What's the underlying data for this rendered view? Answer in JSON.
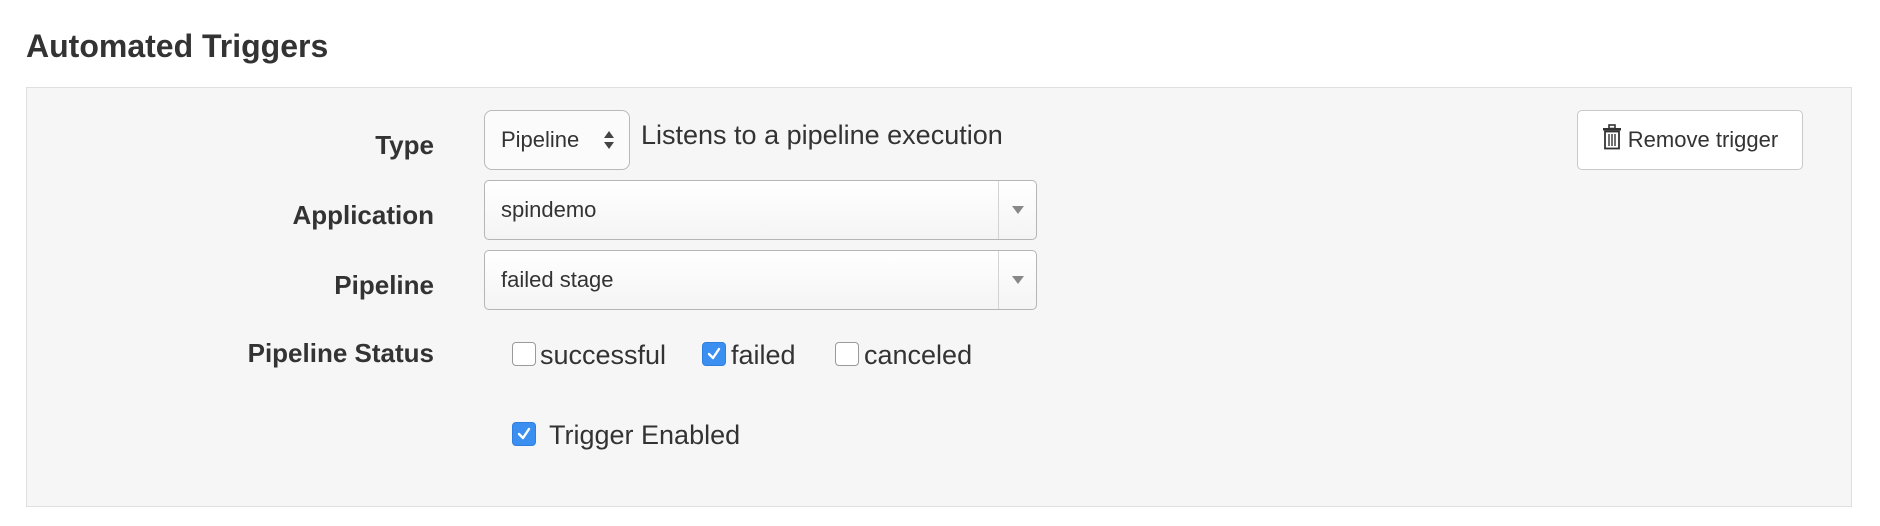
{
  "section": {
    "title": "Automated Triggers"
  },
  "trigger": {
    "type_label": "Type",
    "type_value": "Pipeline",
    "type_description": "Listens to a pipeline execution",
    "remove_label": "Remove trigger",
    "application_label": "Application",
    "application_value": "spindemo",
    "pipeline_label": "Pipeline",
    "pipeline_value": "failed stage",
    "status_label": "Pipeline Status",
    "statuses": [
      {
        "label": "successful",
        "checked": false
      },
      {
        "label": "failed",
        "checked": true
      },
      {
        "label": "canceled",
        "checked": false
      }
    ],
    "enabled_label": "Trigger Enabled",
    "enabled_checked": true
  },
  "icons": {
    "remove": "trash-icon",
    "type_select": "up-down-arrows-icon",
    "dropdown": "caret-down-icon",
    "check": "checkmark-icon"
  },
  "colors": {
    "checkbox_checked": "#3b8ff0",
    "panel_bg": "#f6f6f6"
  }
}
